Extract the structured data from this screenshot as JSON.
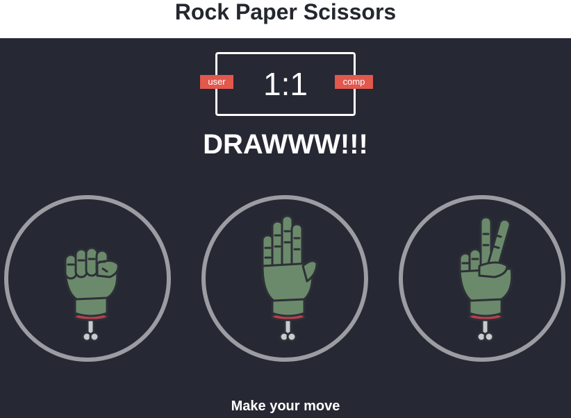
{
  "header": {
    "title": "Rock Paper Scissors"
  },
  "scoreboard": {
    "score_text": "1:1",
    "user_label": "user",
    "comp_label": "comp"
  },
  "result_message": "DRAWWW!!!",
  "choices": [
    {
      "name": "rock",
      "icon": "zombie-fist-icon"
    },
    {
      "name": "paper",
      "icon": "zombie-open-hand-icon"
    },
    {
      "name": "scissors",
      "icon": "zombie-peace-hand-icon"
    }
  ],
  "action_message": "Make your move",
  "colors": {
    "header_bg": "#ffffff",
    "game_bg": "#262833",
    "badge": "#e2584d",
    "ring": "#9b9da3",
    "hand_skin": "#6b8a6b",
    "wrist_wound": "#b8404a"
  }
}
